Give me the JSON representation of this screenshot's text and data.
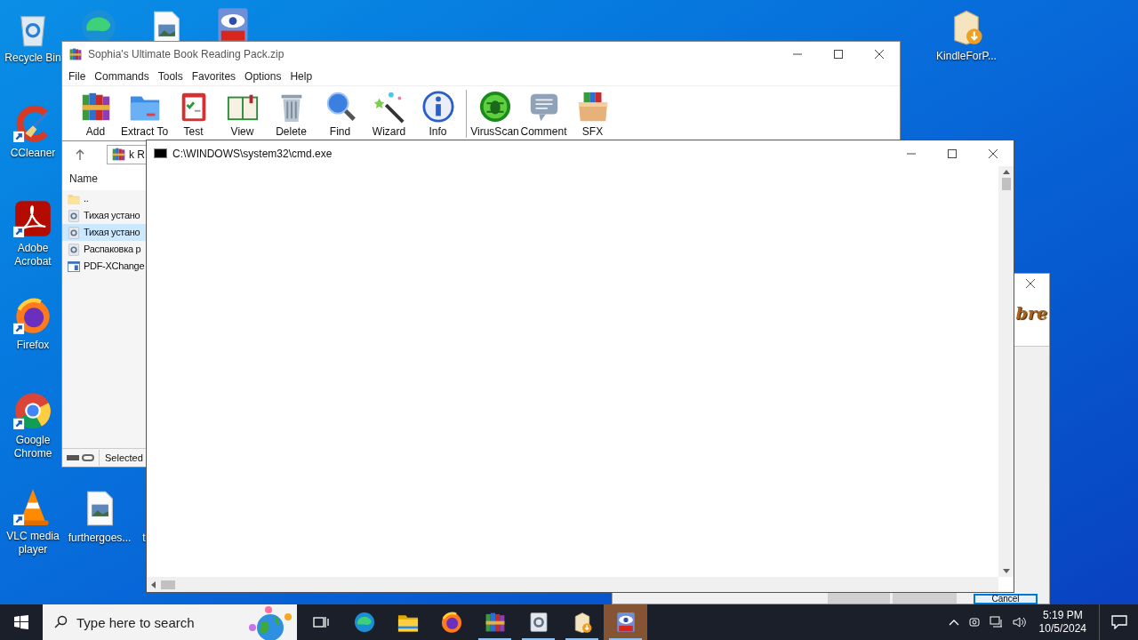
{
  "desktop_icons": [
    {
      "kind": "recycle",
      "label": "Recycle Bin"
    },
    {
      "kind": "edge"
    },
    {
      "kind": "imagefile"
    },
    {
      "kind": "pdfviewer"
    },
    {
      "kind": "ccleaner",
      "label": "CCleaner",
      "shortcut": true
    },
    {
      "kind": "acrobat",
      "label": "Adobe Acrobat",
      "shortcut": true
    },
    {
      "kind": "firefox",
      "label": "Firefox",
      "shortcut": true
    },
    {
      "kind": "chrome",
      "label": "Google Chrome",
      "shortcut": true
    },
    {
      "kind": "vlc",
      "label": "VLC media player",
      "shortcut": true
    },
    {
      "kind": "imagefile",
      "label": "furthergoes..."
    },
    {
      "kind": "none",
      "label": "t"
    },
    {
      "kind": "installer",
      "label": "KindleForP..."
    }
  ],
  "archiver": {
    "title": "Sophia's Ultimate Book Reading Pack.zip",
    "menu": [
      "File",
      "Commands",
      "Tools",
      "Favorites",
      "Options",
      "Help"
    ],
    "toolbar": [
      {
        "kind": "books",
        "label": "Add"
      },
      {
        "kind": "folder",
        "label": "Extract To"
      },
      {
        "kind": "test",
        "label": "Test"
      },
      {
        "kind": "book",
        "label": "View"
      },
      {
        "kind": "trash",
        "label": "Delete"
      },
      {
        "kind": "find",
        "label": "Find"
      },
      {
        "kind": "wand",
        "label": "Wizard"
      },
      {
        "kind": "info",
        "label": "Info"
      },
      {
        "kind": "separator"
      },
      {
        "kind": "bug",
        "label": "VirusScan"
      },
      {
        "kind": "comment",
        "label": "Comment"
      },
      {
        "kind": "box",
        "label": "SFX"
      }
    ],
    "address": "k R",
    "column": "Name",
    "rows": [
      {
        "kind": "folder",
        "name": "..",
        "selected": false
      },
      {
        "kind": "setup",
        "name": "Тихая устано",
        "selected": false
      },
      {
        "kind": "setup",
        "name": "Тихая устано",
        "selected": true
      },
      {
        "kind": "setup",
        "name": "Распаковка р",
        "selected": false
      },
      {
        "kind": "app",
        "name": "PDF-XChange",
        "selected": false
      }
    ],
    "status": "Selected"
  },
  "console": {
    "title": "C:\\WINDOWS\\system32\\cmd.exe"
  },
  "installer": {
    "logo_text": "bre",
    "button": "Cancel"
  },
  "taskbar": {
    "search_placeholder": "Type here to search",
    "apps": [
      {
        "kind": "edge",
        "running": false,
        "selected": false
      },
      {
        "kind": "explorer",
        "running": false,
        "selected": false
      },
      {
        "kind": "firefox",
        "running": false,
        "selected": false
      },
      {
        "kind": "books",
        "running": true,
        "selected": false
      },
      {
        "kind": "setup",
        "running": true,
        "selected": false
      },
      {
        "kind": "installer",
        "running": true,
        "selected": false
      },
      {
        "kind": "pdfviewer",
        "running": true,
        "selected": true
      }
    ],
    "time": "5:19 PM",
    "date": "10/5/2024"
  }
}
